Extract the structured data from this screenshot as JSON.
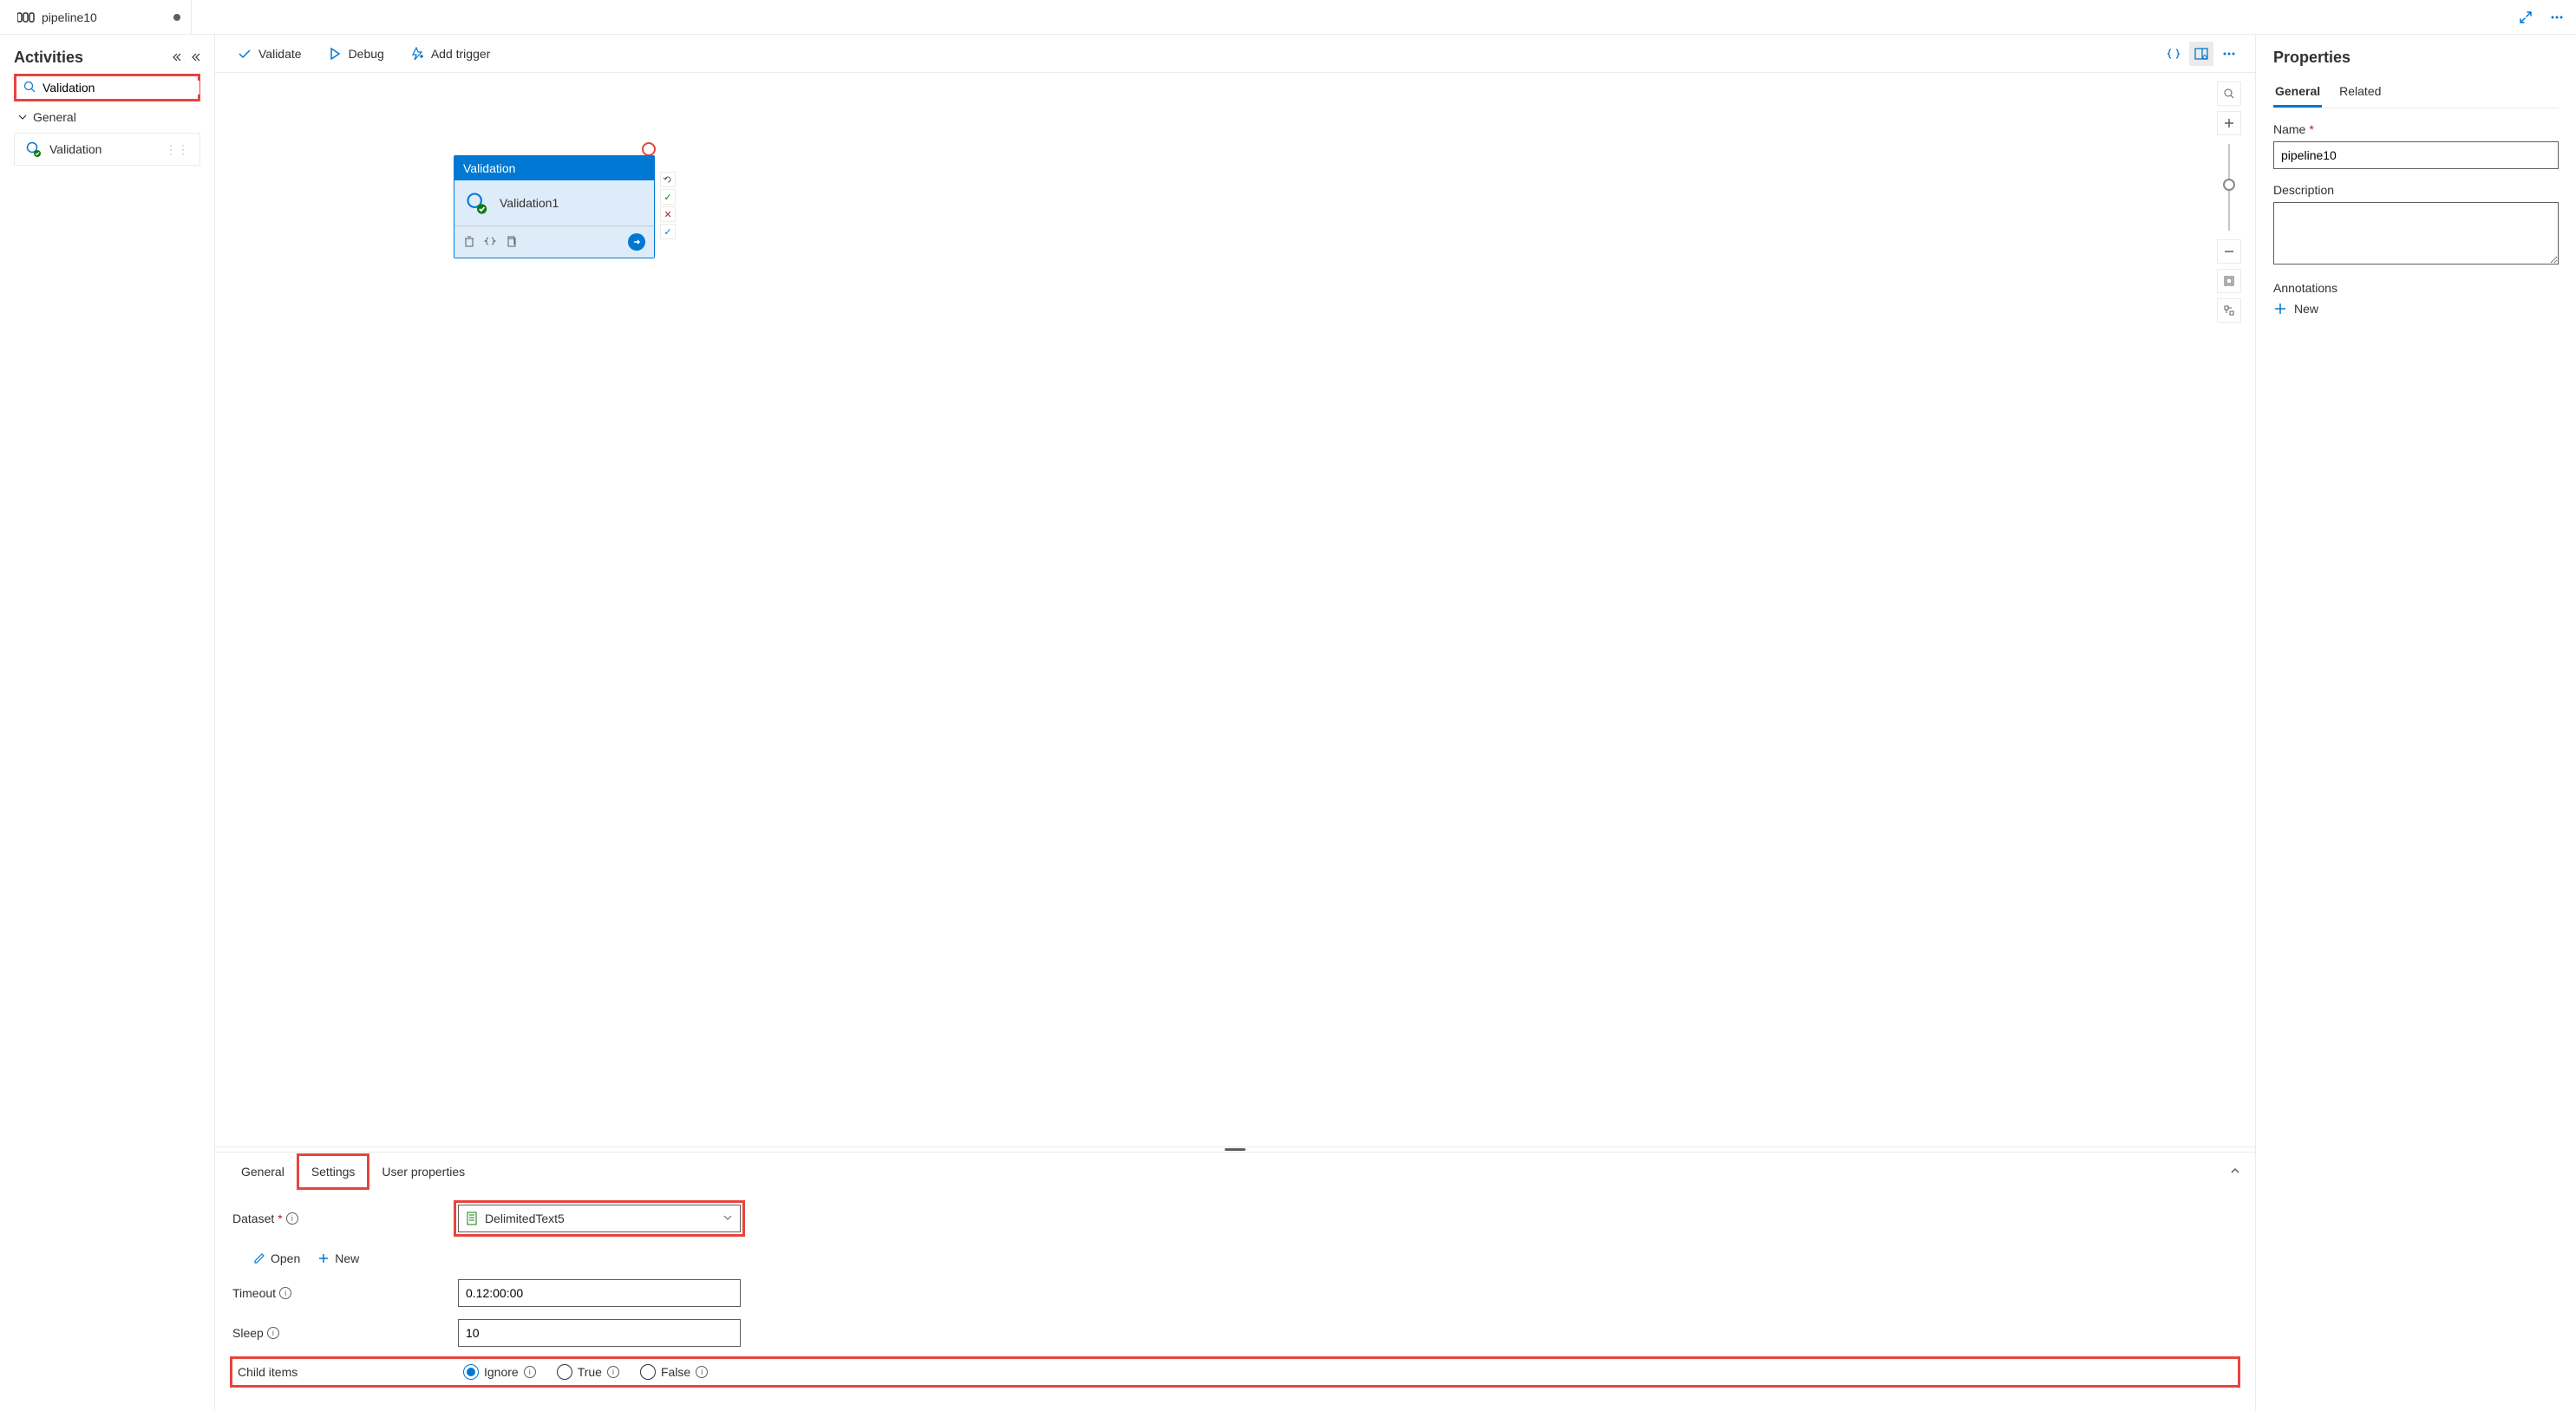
{
  "tab": {
    "title": "pipeline10"
  },
  "sidebar": {
    "title": "Activities",
    "search_value": "Validation",
    "section_general": "General",
    "item_validation": "Validation"
  },
  "toolbar": {
    "validate": "Validate",
    "debug": "Debug",
    "add_trigger": "Add trigger"
  },
  "node": {
    "type": "Validation",
    "name": "Validation1"
  },
  "panel": {
    "tab_general": "General",
    "tab_settings": "Settings",
    "tab_user_properties": "User properties",
    "dataset_label": "Dataset",
    "dataset_value": "DelimitedText5",
    "open_label": "Open",
    "new_label": "New",
    "timeout_label": "Timeout",
    "timeout_value": "0.12:00:00",
    "sleep_label": "Sleep",
    "sleep_value": "10",
    "child_items_label": "Child items",
    "radio_ignore": "Ignore",
    "radio_true": "True",
    "radio_false": "False"
  },
  "props": {
    "title": "Properties",
    "tab_general": "General",
    "tab_related": "Related",
    "name_label": "Name",
    "name_value": "pipeline10",
    "description_label": "Description",
    "description_value": "",
    "annotations_label": "Annotations",
    "new_annotation": "New"
  }
}
